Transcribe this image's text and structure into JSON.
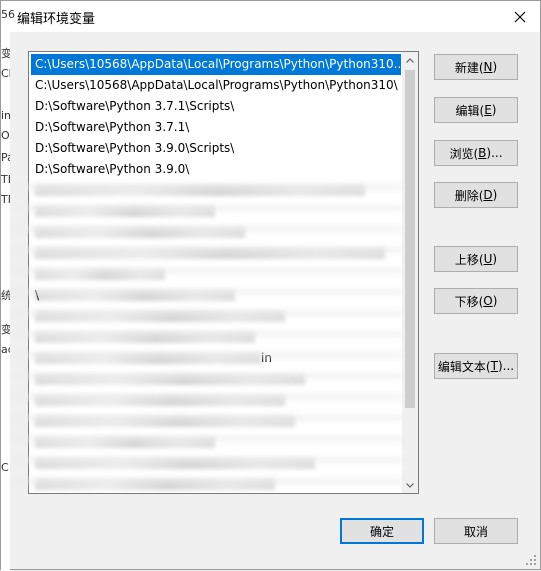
{
  "window": {
    "title": "编辑环境变量",
    "close_glyph": "✕"
  },
  "background_fragments": [
    "56",
    "变",
    "Ch",
    "in",
    "O",
    "Pa",
    "TE",
    "TM",
    "统",
    "变",
    "ad",
    "C"
  ],
  "paths": {
    "items": [
      {
        "text": "C:\\Users\\10568\\AppData\\Local\\Programs\\Python\\Python310...",
        "selected": true
      },
      {
        "text": "C:\\Users\\10568\\AppData\\Local\\Programs\\Python\\Python310\\",
        "selected": false
      },
      {
        "text": "D:\\Software\\Python 3.7.1\\Scripts\\",
        "selected": false
      },
      {
        "text": "D:\\Software\\Python 3.7.1\\",
        "selected": false
      },
      {
        "text": "D:\\Software\\Python 3.9.0\\Scripts\\",
        "selected": false
      },
      {
        "text": "D:\\Software\\Python 3.9.0\\",
        "selected": false
      }
    ],
    "partial_fragments": {
      "row_8": "\\",
      "row_13": "in"
    }
  },
  "buttons": {
    "new": {
      "label": "新建(",
      "mnemonic": "N",
      "suffix": ")"
    },
    "edit": {
      "label": "编辑(",
      "mnemonic": "E",
      "suffix": ")"
    },
    "browse": {
      "label": "浏览(",
      "mnemonic": "B",
      "suffix": ")..."
    },
    "delete": {
      "label": "删除(",
      "mnemonic": "D",
      "suffix": ")"
    },
    "move_up": {
      "label": "上移(",
      "mnemonic": "U",
      "suffix": ")"
    },
    "move_down": {
      "label": "下移(",
      "mnemonic": "O",
      "suffix": ")"
    },
    "edit_text": {
      "label": "编辑文本(",
      "mnemonic": "T",
      "suffix": ")..."
    },
    "ok": {
      "label": "确定"
    },
    "cancel": {
      "label": "取消"
    }
  },
  "colors": {
    "selection": "#0078d7",
    "default_button_border": "#0078d7"
  }
}
